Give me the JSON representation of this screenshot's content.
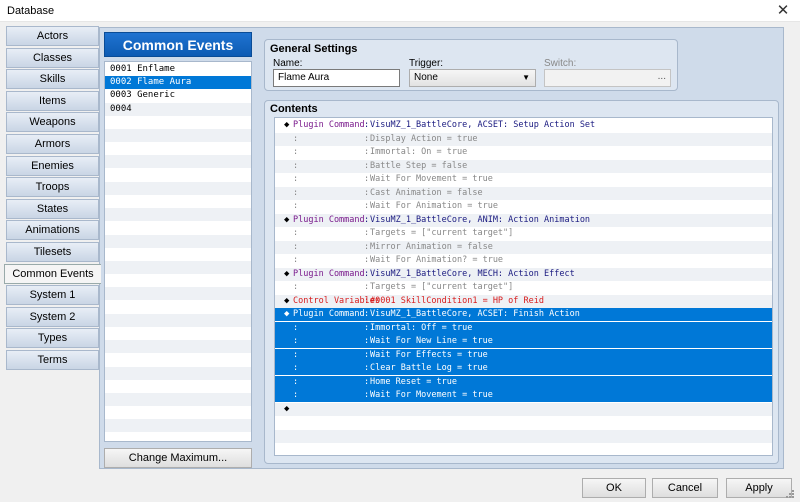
{
  "window": {
    "title": "Database",
    "close_glyph": "✕"
  },
  "tabs": [
    {
      "label": "Actors"
    },
    {
      "label": "Classes"
    },
    {
      "label": "Skills"
    },
    {
      "label": "Items"
    },
    {
      "label": "Weapons"
    },
    {
      "label": "Armors"
    },
    {
      "label": "Enemies"
    },
    {
      "label": "Troops"
    },
    {
      "label": "States"
    },
    {
      "label": "Animations"
    },
    {
      "label": "Tilesets"
    },
    {
      "label": "Common Events"
    },
    {
      "label": "System 1"
    },
    {
      "label": "System 2"
    },
    {
      "label": "Types"
    },
    {
      "label": "Terms"
    }
  ],
  "active_tab": "Common Events",
  "common_events": {
    "header": "Common Events",
    "items": [
      {
        "text": "0001 Enflame"
      },
      {
        "text": "0002 Flame Aura"
      },
      {
        "text": "0003 Generic"
      },
      {
        "text": "0004"
      }
    ],
    "selected_index": 1,
    "change_max_label": "Change Maximum..."
  },
  "general": {
    "title": "General Settings",
    "name_label": "Name:",
    "name_value": "Flame Aura",
    "trigger_label": "Trigger:",
    "trigger_value": "None",
    "switch_label": "Switch:",
    "switch_button": "..."
  },
  "contents": {
    "title": "Contents",
    "lines": [
      {
        "mark": "◆",
        "name": "Plugin Command",
        "type": "cmd",
        "text": "VisuMZ_1_BattleCore, ACSET: Setup Action Set"
      },
      {
        "mark": "",
        "name": ":",
        "type": "arg",
        "text": "Display Action = true"
      },
      {
        "mark": "",
        "name": ":",
        "type": "arg",
        "text": "Immortal: On = true"
      },
      {
        "mark": "",
        "name": ":",
        "type": "arg",
        "text": "Battle Step = false"
      },
      {
        "mark": "",
        "name": ":",
        "type": "arg",
        "text": "Wait For Movement = true"
      },
      {
        "mark": "",
        "name": ":",
        "type": "arg",
        "text": "Cast Animation = false"
      },
      {
        "mark": "",
        "name": ":",
        "type": "arg",
        "text": "Wait For Animation = true"
      },
      {
        "mark": "◆",
        "name": "Plugin Command",
        "type": "cmd",
        "text": "VisuMZ_1_BattleCore, ANIM: Action Animation"
      },
      {
        "mark": "",
        "name": ":",
        "type": "arg",
        "text": "Targets = [\"current target\"]"
      },
      {
        "mark": "",
        "name": ":",
        "type": "arg",
        "text": "Mirror Animation = false"
      },
      {
        "mark": "",
        "name": ":",
        "type": "arg",
        "text": "Wait For Animation? = true"
      },
      {
        "mark": "◆",
        "name": "Plugin Command",
        "type": "cmd",
        "text": "VisuMZ_1_BattleCore, MECH: Action Effect"
      },
      {
        "mark": "",
        "name": ":",
        "type": "arg",
        "text": "Targets = [\"current target\"]"
      },
      {
        "mark": "◆",
        "name": "Control Variables",
        "type": "var",
        "text": "#0001 SkillCondition1 = HP of Reid"
      },
      {
        "mark": "◆",
        "name": "Plugin Command",
        "type": "cmd",
        "text": "VisuMZ_1_BattleCore, ACSET: Finish Action",
        "sel": true
      },
      {
        "mark": "",
        "name": ":",
        "type": "arg",
        "text": "Immortal: Off = true",
        "sel": true
      },
      {
        "mark": "",
        "name": ":",
        "type": "arg",
        "text": "Wait For New Line = true",
        "sel": true
      },
      {
        "mark": "",
        "name": ":",
        "type": "arg",
        "text": "Wait For Effects = true",
        "sel": true
      },
      {
        "mark": "",
        "name": ":",
        "type": "arg",
        "text": "Clear Battle Log = true",
        "sel": true
      },
      {
        "mark": "",
        "name": ":",
        "type": "arg",
        "text": "Home Reset = true",
        "sel": true
      },
      {
        "mark": "",
        "name": ":",
        "type": "arg",
        "text": "Wait For Movement = true",
        "sel": true
      },
      {
        "mark": "◆",
        "name": "",
        "type": "end",
        "text": ""
      }
    ]
  },
  "footer": {
    "ok": "OK",
    "cancel": "Cancel",
    "apply": "Apply"
  },
  "colors": {
    "selection": "#0078d7",
    "header": "#1565c0",
    "plugin": "#7a1a8c",
    "args": "#1a1a80",
    "variable": "#d81c1c"
  }
}
